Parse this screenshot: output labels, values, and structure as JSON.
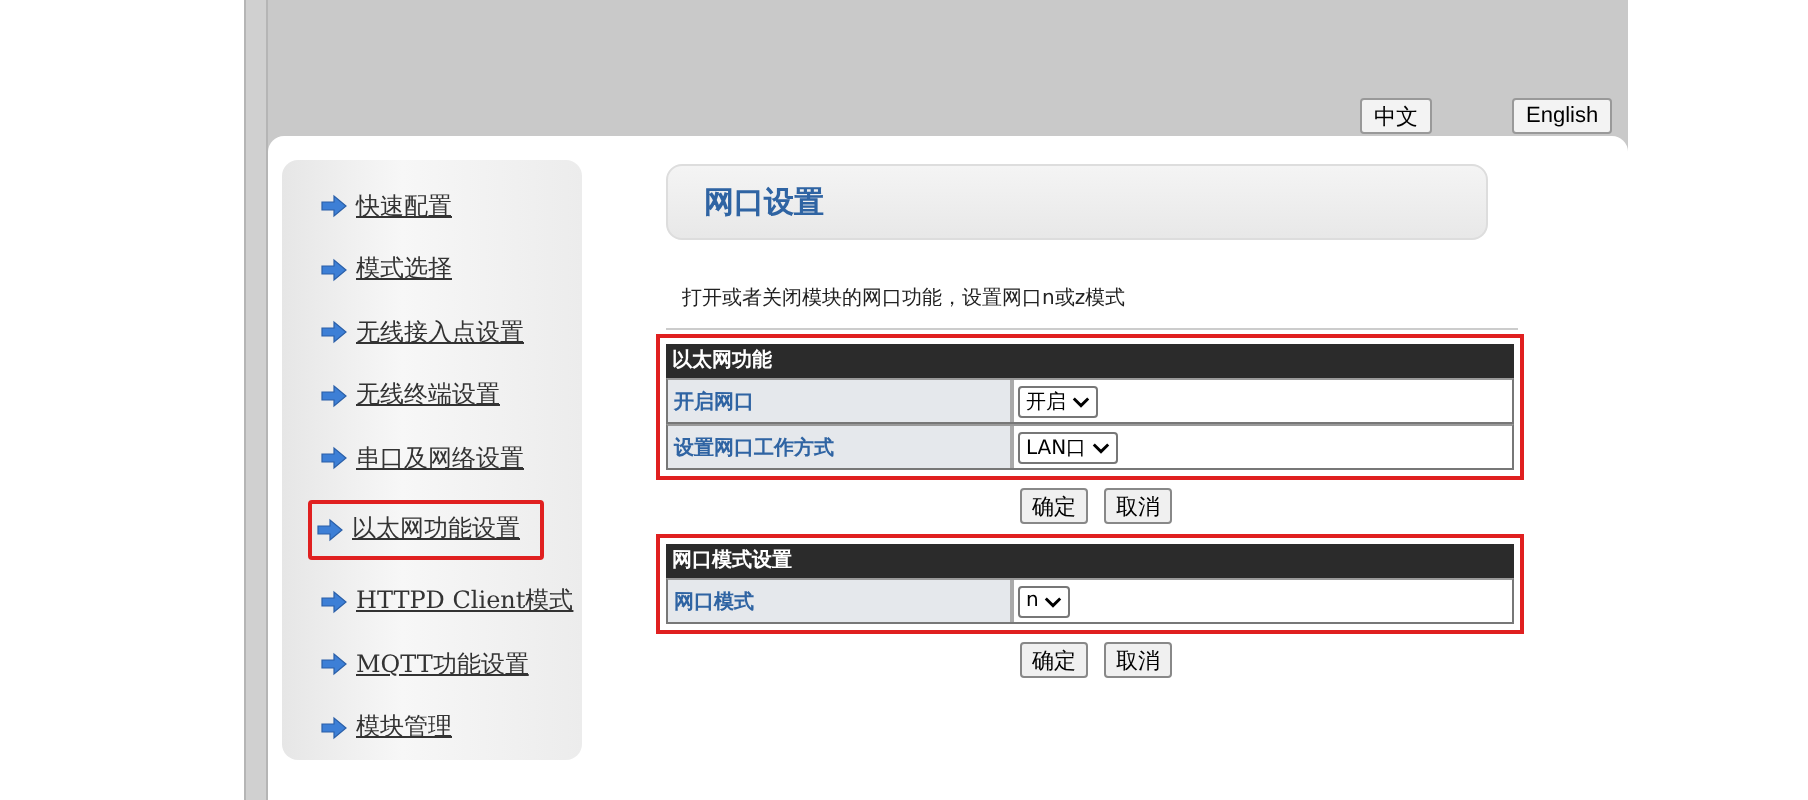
{
  "language_buttons": [
    "中文",
    "English"
  ],
  "sidebar": {
    "items": [
      {
        "label": "快速配置",
        "highlighted": false
      },
      {
        "label": "模式选择",
        "highlighted": false
      },
      {
        "label": "无线接入点设置",
        "highlighted": false
      },
      {
        "label": "无线终端设置",
        "highlighted": false
      },
      {
        "label": "串口及网络设置",
        "highlighted": false
      },
      {
        "label": "以太网功能设置",
        "highlighted": true
      },
      {
        "label": "HTTPD Client模式",
        "highlighted": false
      },
      {
        "label": "MQTT功能设置",
        "highlighted": false
      },
      {
        "label": "模块管理",
        "highlighted": false
      }
    ]
  },
  "page_title": "网口设置",
  "description": "打开或者关闭模块的网口功能，设置网口n或z模式",
  "sections": [
    {
      "title": "以太网功能",
      "highlighted": true,
      "rows": [
        {
          "label": "开启网口",
          "value": "开启"
        },
        {
          "label": "设置网口工作方式",
          "value": "LAN口"
        }
      ],
      "buttons": [
        "确定",
        "取消"
      ]
    },
    {
      "title": "网口模式设置",
      "highlighted": true,
      "rows": [
        {
          "label": "网口模式",
          "value": "n"
        }
      ],
      "buttons": [
        "确定",
        "取消"
      ]
    }
  ]
}
